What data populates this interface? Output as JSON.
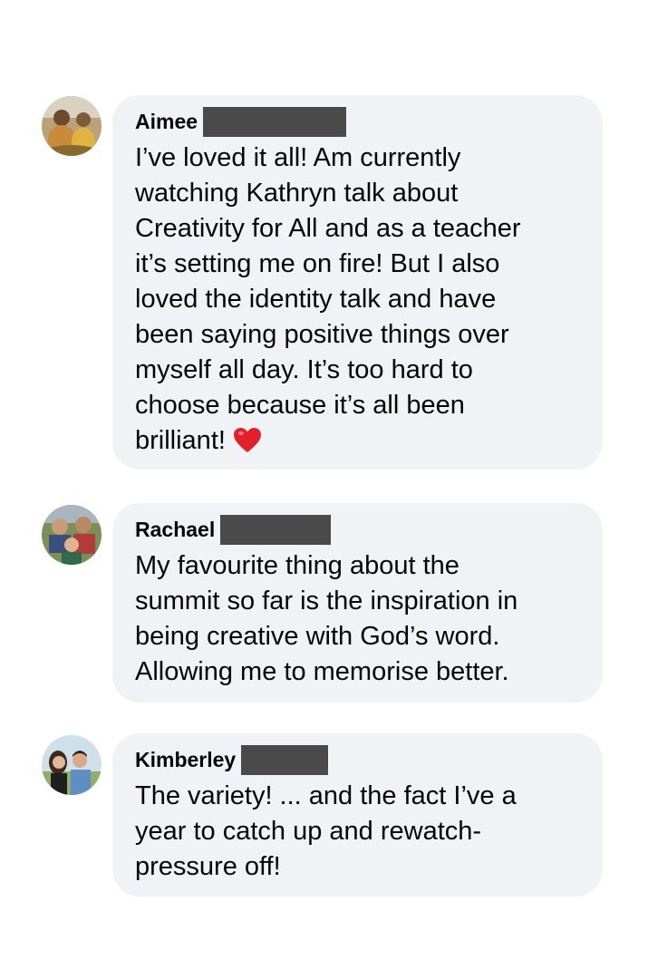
{
  "comments": [
    {
      "author": "Aimee",
      "text": "I’ve loved it all! Am currently\nwatching Kathryn talk about\nCreativity for All and as a teacher\nit’s setting me on fire! But I also\nloved the identity talk and have\nbeen saying positive things over\nmyself all day. It’s too hard to\nchoose because it’s all been\nbrilliant!",
      "emoji": "red-heart-icon"
    },
    {
      "author": "Rachael",
      "text": "My favourite thing about the\nsummit so far is the inspiration in\nbeing creative with God’s word.\nAllowing me to memorise better."
    },
    {
      "author": "Kimberley",
      "text": "The variety! ... and the fact I’ve a\nyear to catch up and rewatch-\npressure off!"
    }
  ],
  "colors": {
    "bubble": "#f0f2f5",
    "text": "#050505",
    "redaction": "#4a4a4a",
    "heart": "#e0202a"
  }
}
